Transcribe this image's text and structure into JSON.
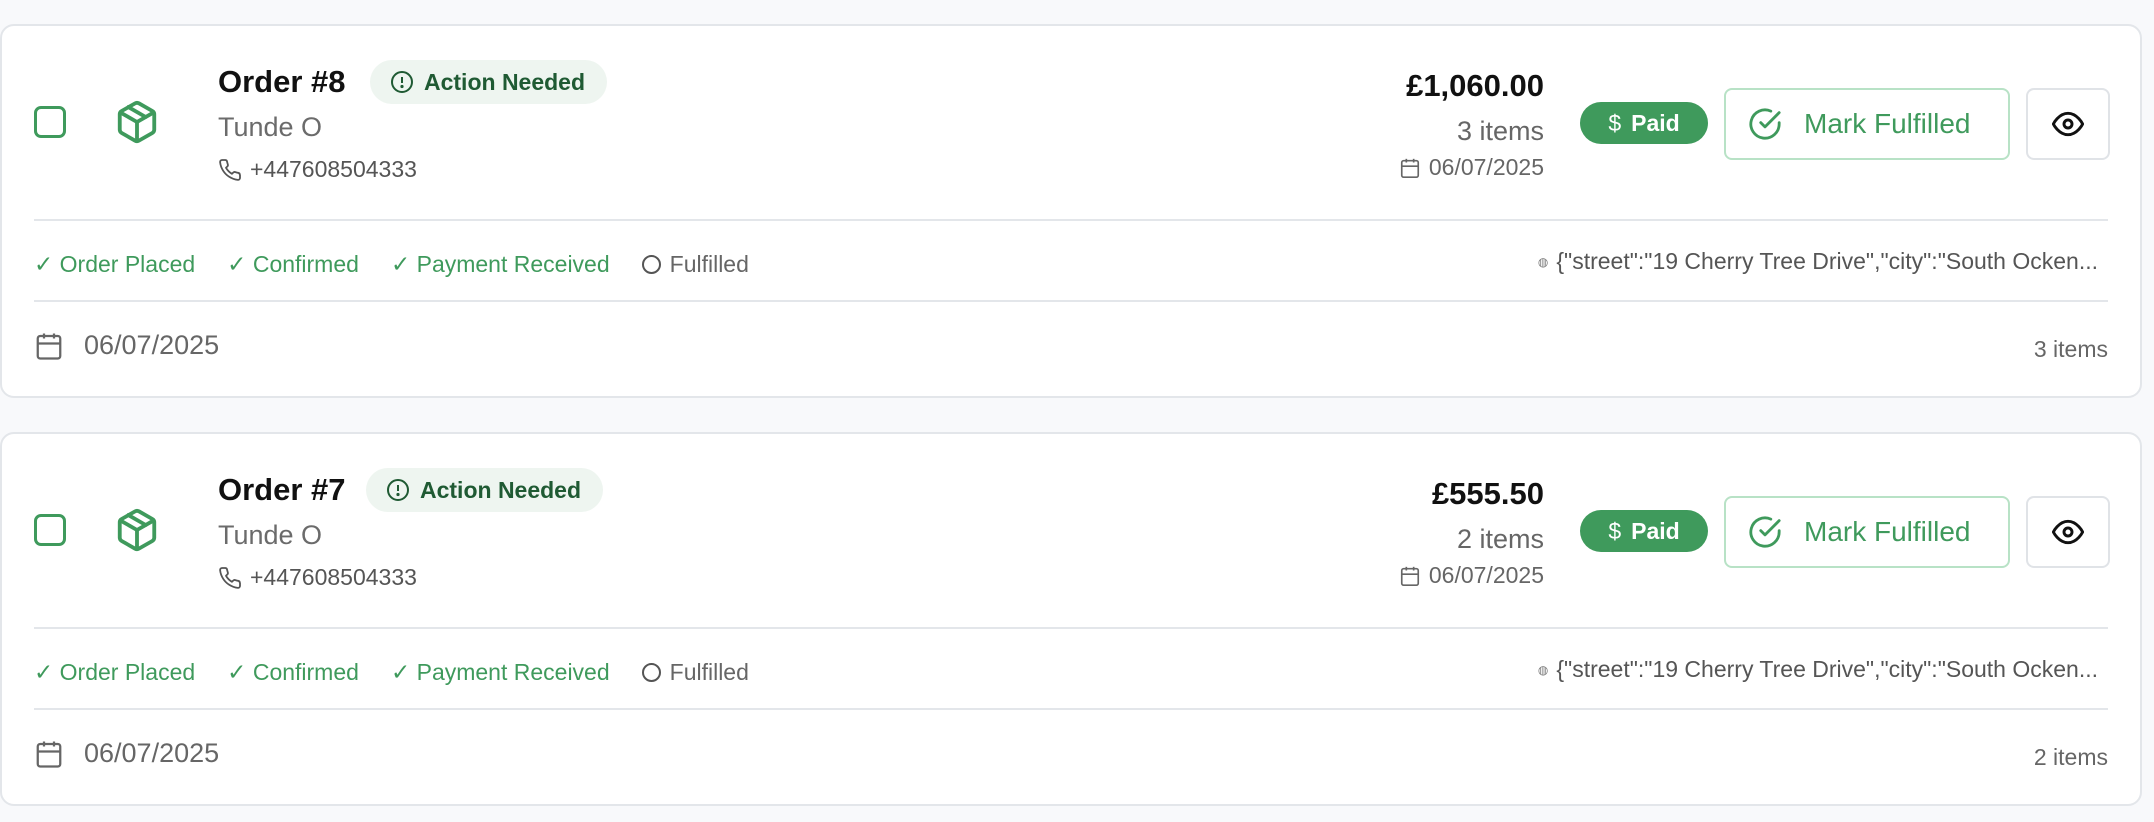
{
  "colors": {
    "accent": "#3f9a5c",
    "badge_bg": "#eef5f0",
    "badge_text": "#1f5a33"
  },
  "orders": [
    {
      "title": "Order #8",
      "status_badge": "Action Needed",
      "customer": "Tunde O",
      "phone": "+447608504333",
      "total": "£1,060.00",
      "items": "3 items",
      "date": "06/07/2025",
      "payment_status": "Paid",
      "action_label": "Mark Fulfilled",
      "steps": [
        {
          "label": "✓ Order Placed",
          "done": true
        },
        {
          "label": "✓ Confirmed",
          "done": true
        },
        {
          "label": "✓ Payment Received",
          "done": true
        },
        {
          "label": "Fulfilled",
          "done": false
        }
      ],
      "address": "{\"street\":\"19 Cherry Tree Drive\",\"city\":\"South Ocken...",
      "footer_date": "06/07/2025",
      "footer_items": "3 items"
    },
    {
      "title": "Order #7",
      "status_badge": "Action Needed",
      "customer": "Tunde O",
      "phone": "+447608504333",
      "total": "£555.50",
      "items": "2 items",
      "date": "06/07/2025",
      "payment_status": "Paid",
      "action_label": "Mark Fulfilled",
      "steps": [
        {
          "label": "✓ Order Placed",
          "done": true
        },
        {
          "label": "✓ Confirmed",
          "done": true
        },
        {
          "label": "✓ Payment Received",
          "done": true
        },
        {
          "label": "Fulfilled",
          "done": false
        }
      ],
      "address": "{\"street\":\"19 Cherry Tree Drive\",\"city\":\"South Ocken...",
      "footer_date": "06/07/2025",
      "footer_items": "2 items"
    }
  ]
}
